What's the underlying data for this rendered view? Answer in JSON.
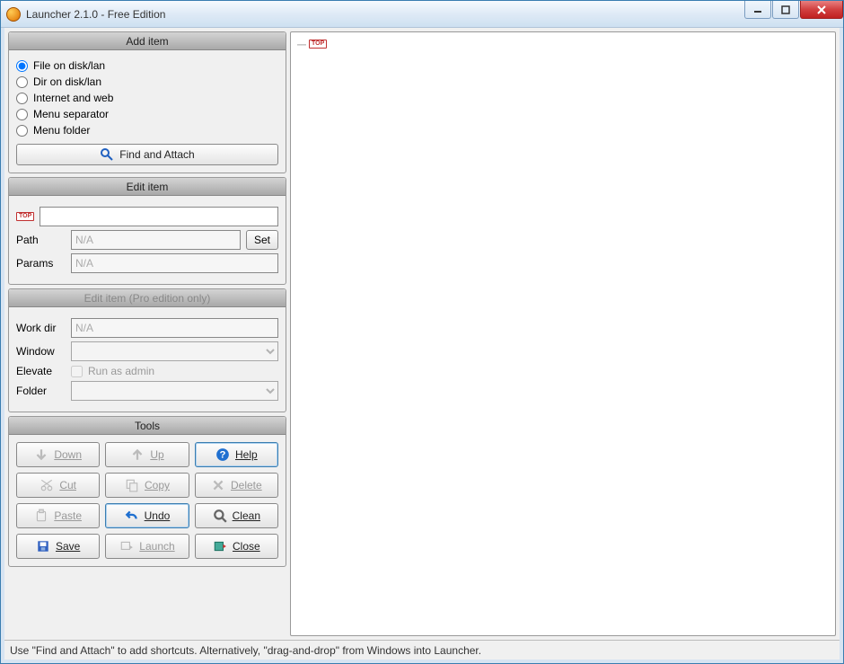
{
  "title": "Launcher 2.1.0 - Free Edition",
  "addItem": {
    "header": "Add item",
    "options": [
      "File on disk/lan",
      "Dir on disk/lan",
      "Internet and web",
      "Menu separator",
      "Menu folder"
    ],
    "findAttach": "Find and Attach"
  },
  "editItem": {
    "header": "Edit item",
    "pathLabel": "Path",
    "pathPlaceholder": "N/A",
    "setLabel": "Set",
    "paramsLabel": "Params",
    "paramsPlaceholder": "N/A"
  },
  "editItemPro": {
    "header": "Edit item (Pro edition only)",
    "workDirLabel": "Work dir",
    "workDirPlaceholder": "N/A",
    "windowLabel": "Window",
    "elevateLabel": "Elevate",
    "runAdminLabel": "Run as admin",
    "folderLabel": "Folder"
  },
  "tools": {
    "header": "Tools",
    "down": "Down",
    "up": "Up",
    "help": "Help",
    "cut": "Cut",
    "copy": "Copy",
    "delete": "Delete",
    "paste": "Paste",
    "undo": "Undo",
    "clean": "Clean",
    "save": "Save",
    "launch": "Launch",
    "close": "Close"
  },
  "tree": {
    "rootBadge": "TOP"
  },
  "status": "Use \"Find and Attach\" to add shortcuts. Alternatively, \"drag-and-drop\" from Windows into Launcher."
}
